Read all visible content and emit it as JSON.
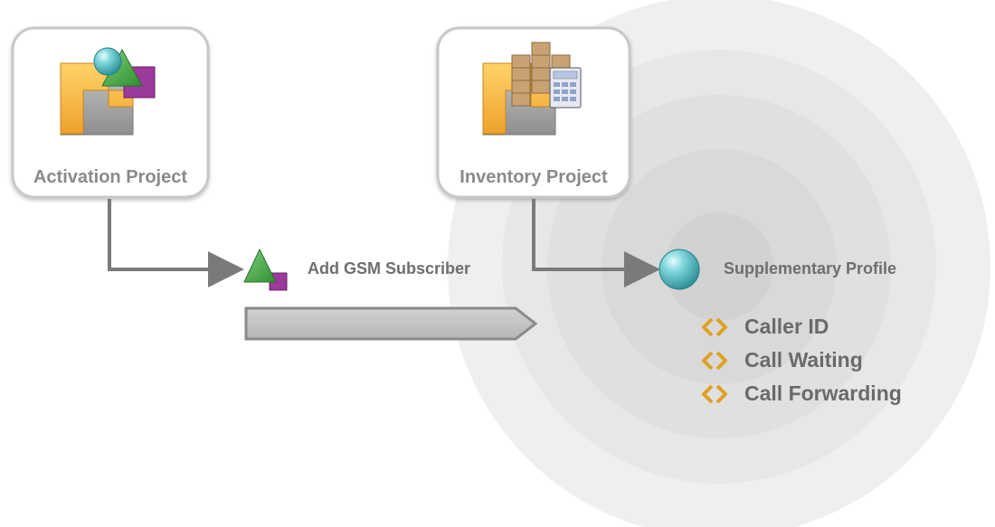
{
  "projects": [
    {
      "id": "activation",
      "label": "Activation Project",
      "icon": "activation-project-icon"
    },
    {
      "id": "inventory",
      "label": "Inventory Project",
      "icon": "inventory-project-icon"
    }
  ],
  "nodes": {
    "add_gsm": {
      "label": "Add GSM Subscriber",
      "icon": "shape-group-icon"
    },
    "supplementary": {
      "label": "Supplementary Profile",
      "icon": "sphere-icon"
    }
  },
  "features": [
    {
      "label": "Caller ID",
      "icon": "diamond-brackets-icon"
    },
    {
      "label": "Call Waiting",
      "icon": "diamond-brackets-icon"
    },
    {
      "label": "Call Forwarding",
      "icon": "diamond-brackets-icon"
    }
  ],
  "colors": {
    "ring_outer": "#efefef",
    "ring_2": "#e7e7e7",
    "ring_3": "#e0e0e0",
    "ring_4": "#d9d9d9",
    "ring_inner": "#d2d2d2",
    "connector": "#7a7a7a",
    "folder_orange": "#f2b33d",
    "sphere_teal": "#3fb1b8",
    "triangle_green": "#3aa43a",
    "square_purple": "#9b3a9b",
    "box_tan": "#c9a273",
    "feature_icon": "#e0a020"
  }
}
